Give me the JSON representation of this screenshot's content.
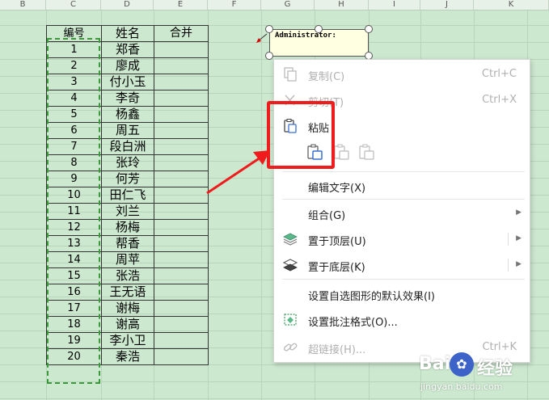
{
  "columns": [
    "B",
    "C",
    "D",
    "E",
    "F",
    "G",
    "H",
    "I",
    "J",
    "K"
  ],
  "table": {
    "headers": [
      "编号",
      "姓名",
      "合并"
    ],
    "rows": [
      [
        "1",
        "郑香"
      ],
      [
        "2",
        "廖成"
      ],
      [
        "3",
        "付小玉"
      ],
      [
        "4",
        "李奇"
      ],
      [
        "5",
        "杨鑫"
      ],
      [
        "6",
        "周五"
      ],
      [
        "7",
        "段白洲"
      ],
      [
        "8",
        "张玲"
      ],
      [
        "9",
        "何芳"
      ],
      [
        "10",
        "田仁飞"
      ],
      [
        "11",
        "刘兰"
      ],
      [
        "12",
        "杨梅"
      ],
      [
        "13",
        "帮香"
      ],
      [
        "14",
        "周苹"
      ],
      [
        "15",
        "张浩"
      ],
      [
        "16",
        "王无语"
      ],
      [
        "17",
        "谢梅"
      ],
      [
        "18",
        "谢高"
      ],
      [
        "19",
        "李小卫"
      ],
      [
        "20",
        "秦浩"
      ]
    ]
  },
  "comment": {
    "author": "Administrator:"
  },
  "menu": {
    "copy": {
      "label": "复制(C)",
      "shortcut": "Ctrl+C"
    },
    "cut": {
      "label": "剪切(T)",
      "shortcut": "Ctrl+X"
    },
    "paste": {
      "label": "粘贴"
    },
    "edit_text": {
      "label": "编辑文字(X)"
    },
    "group": {
      "label": "组合(G)"
    },
    "bring_front": {
      "label": "置于顶层(U)"
    },
    "send_back": {
      "label": "置于底层(K)"
    },
    "default_effect": {
      "label": "设置自选图形的默认效果(I)"
    },
    "comment_format": {
      "label": "设置批注格式(O)..."
    },
    "hyperlink": {
      "label": "超链接(H)...",
      "shortcut": "Ctrl+K"
    }
  },
  "watermark": {
    "brand1": "Bai",
    "brand2": "经验",
    "url": "jingyan.baidu.com"
  },
  "colors": {
    "sheet_bg": "#cce8cf",
    "highlight": "#ee1c1c",
    "selection_dash": "#3a9a3a"
  }
}
